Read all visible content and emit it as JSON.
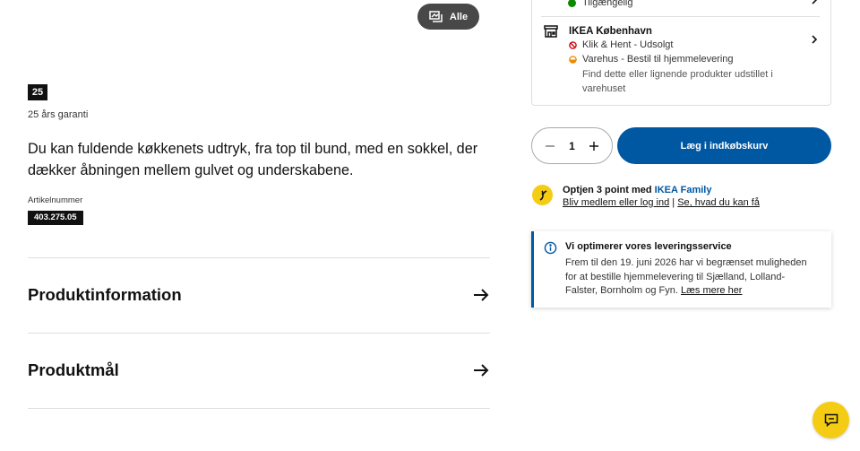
{
  "media": {
    "all_label": "Alle"
  },
  "warranty": {
    "badge": "25",
    "text": "25 års garanti"
  },
  "description": "Du kan fuldende køkkenets udtryk, fra top til bund, med en sokkel, der dækker åbningen mellem gulvet og underskabene.",
  "article": {
    "label": "Artikelnummer",
    "number": "403.275.05"
  },
  "accordion": [
    {
      "title": "Produktinformation"
    },
    {
      "title": "Produktmål"
    }
  ],
  "availability": {
    "online_status": "Tilgængelig",
    "store": {
      "name": "IKEA København",
      "click_collect": "Klik & Hent - Udsolgt",
      "warehouse": "Varehus - Bestil til hjemmelevering",
      "note": "Find dette eller lignende produkter udstillet i varehuset"
    }
  },
  "quantity": {
    "value": "1"
  },
  "cart": {
    "label": "Læg i indkøbskurv"
  },
  "family": {
    "prefix": "Optjen 3 point med ",
    "brand": "IKEA Family",
    "link1": "Bliv medlem eller log ind",
    "separator": " | ",
    "link2": "Se, hvad du kan få"
  },
  "notice": {
    "title": "Vi optimerer vores leveringsservice",
    "body": "Frem til den 19. juni 2026 har vi begrænset muligheden for at bestille hjemmelevering til Sjælland, Lolland-Falster, Bornholm og Fyn. ",
    "link": "Læs mere her"
  },
  "colors": {
    "primary_blue": "#0058a3",
    "family_yellow": "#f5cc14",
    "status_green": "#0a8a00",
    "status_red": "#cc0008",
    "status_orange": "#ed8b00"
  }
}
